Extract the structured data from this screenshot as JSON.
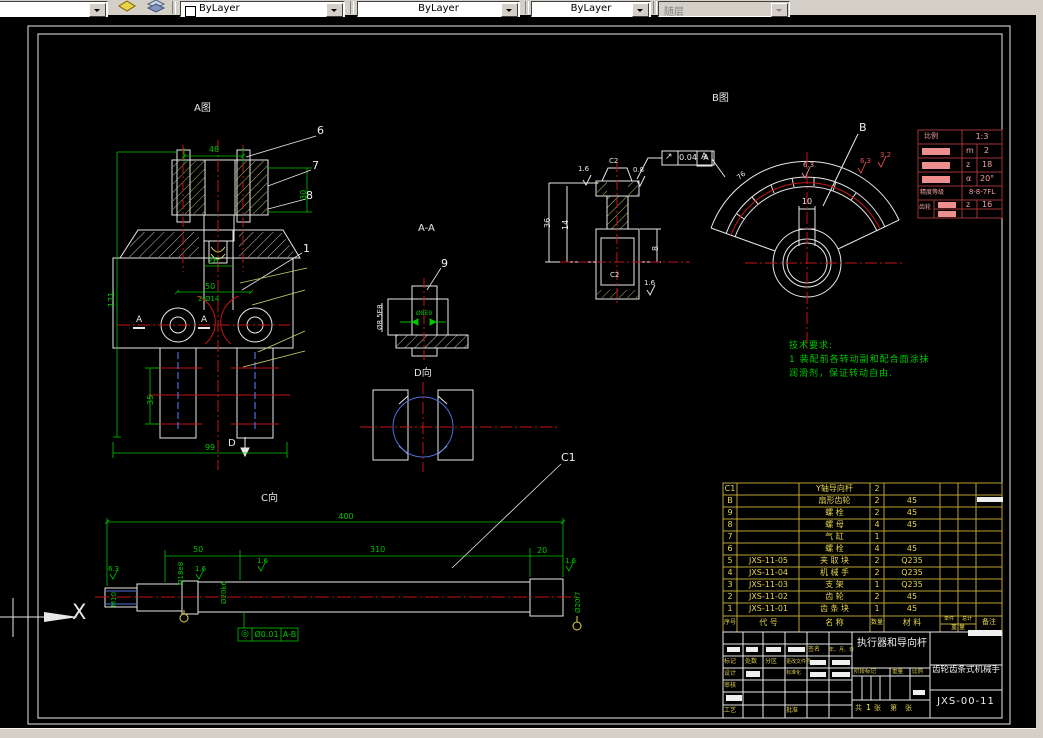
{
  "toolbar": {
    "color_value": "ByLayer",
    "linetype_value": "ByLayer",
    "lineweight_value": "ByLayer",
    "plotstyle_value": "随层"
  },
  "view_labels": {
    "a": "A图",
    "b": "B图",
    "aa": "A-A",
    "d": "D向",
    "c": "C向",
    "x_axis": "X"
  },
  "balloons": {
    "n1": "1",
    "n6": "6",
    "n7": "7",
    "n8": "8",
    "n9": "9",
    "nb": "B",
    "nc1": "C1"
  },
  "tech_req": {
    "title": "技术要求:",
    "line1": "1 装配前各转动副和配合面涂抹",
    "line2": "润滑剂，保证转动自由."
  },
  "dims": {
    "a48": "48",
    "a30": "30",
    "a26": "26",
    "a50": "50",
    "aholes": "2-Ø14",
    "a171": "171",
    "a35": "35",
    "a99": "99",
    "asec": "A",
    "ad": "D",
    "aa_bore": "Ø8.5E8",
    "aa_pin": "Ø8E9",
    "b16a": "1.6",
    "bc2a": "C2",
    "b08": "0.8",
    "btol_sym": "↗",
    "btol_val": "0.04",
    "btol_ref": "A",
    "b36": "36",
    "b14": "14",
    "b8": "8",
    "bc2b": "C2",
    "b16b": "1.6",
    "g10": "10",
    "g63": "6.3",
    "g63r": "6.3",
    "g32r": "3.2",
    "g76": "76",
    "gdatum": "A",
    "c400": "400",
    "c50": "50",
    "c310": "310",
    "c20": "20",
    "c63": "6.3",
    "cm10": "M10",
    "cd18": "Ø18e8",
    "c16a": "1.6",
    "cd20k": "Ø20k6",
    "c16b": "1.6",
    "c16c": "1.6",
    "cd20f": "Ø20f7",
    "ctol_sym": "◎",
    "ctol_val": "Ø0.01",
    "ctol_ref": "A-B"
  },
  "param_table": {
    "r1_label": "比例",
    "r1_val": "1:3",
    "r2_sym": "m",
    "r2_val": "2",
    "r3_sym": "z",
    "r3_val": "18",
    "r4_sym": "α",
    "r4_val": "20°",
    "r5_label": "精度等级",
    "r5_val": "8-8-7FL",
    "r6_label": "齿轮",
    "r6_sym": "z",
    "r6_val": "16"
  },
  "bom": {
    "headers": {
      "no": "序号",
      "code": "代  号",
      "name": "名  称",
      "qty": "数量",
      "mat": "材  料",
      "unit": "单件",
      "total": "总计",
      "weight": "重 量",
      "note": "备注"
    },
    "rows": [
      {
        "no": "C1",
        "code": "",
        "name": "Y轴导向杆",
        "qty": "2",
        "mat": ""
      },
      {
        "no": "B",
        "code": "",
        "name": "扇形齿轮",
        "qty": "2",
        "mat": "45"
      },
      {
        "no": "9",
        "code": "",
        "name": "螺  栓",
        "qty": "2",
        "mat": "45"
      },
      {
        "no": "8",
        "code": "",
        "name": "螺  母",
        "qty": "4",
        "mat": "45"
      },
      {
        "no": "7",
        "code": "",
        "name": "气  缸",
        "qty": "1",
        "mat": ""
      },
      {
        "no": "6",
        "code": "",
        "name": "螺  栓",
        "qty": "4",
        "mat": "45"
      },
      {
        "no": "5",
        "code": "JXS-11-05",
        "name": "夹 取 块",
        "qty": "2",
        "mat": "Q235"
      },
      {
        "no": "4",
        "code": "JXS-11-04",
        "name": "机 械 手",
        "qty": "2",
        "mat": "Q235"
      },
      {
        "no": "3",
        "code": "JXS-11-03",
        "name": "支  架",
        "qty": "1",
        "mat": "Q235"
      },
      {
        "no": "2",
        "code": "JXS-11-02",
        "name": "齿  轮",
        "qty": "2",
        "mat": "45"
      },
      {
        "no": "1",
        "code": "JXS-11-01",
        "name": "齿 条 块",
        "qty": "1",
        "mat": "45"
      }
    ]
  },
  "title_block": {
    "title": "执行器和导向杆",
    "project": "齿轮齿条式机械手",
    "drawing_no": "JXS-00-11",
    "labels": {
      "mark": "标记",
      "count": "处数",
      "zone": "分区",
      "file": "更改文件号",
      "sign": "签名",
      "date": "年、月、日",
      "design": "设计",
      "standard": "标准化",
      "audit": "审核",
      "process": "工艺",
      "approve": "批准",
      "stage": "阶段标记",
      "weight": "重量",
      "scale": "比例",
      "total": "共",
      "sheet_n": "1",
      "sheet_u": "张",
      "page": "第",
      "page_u": "张"
    }
  }
}
